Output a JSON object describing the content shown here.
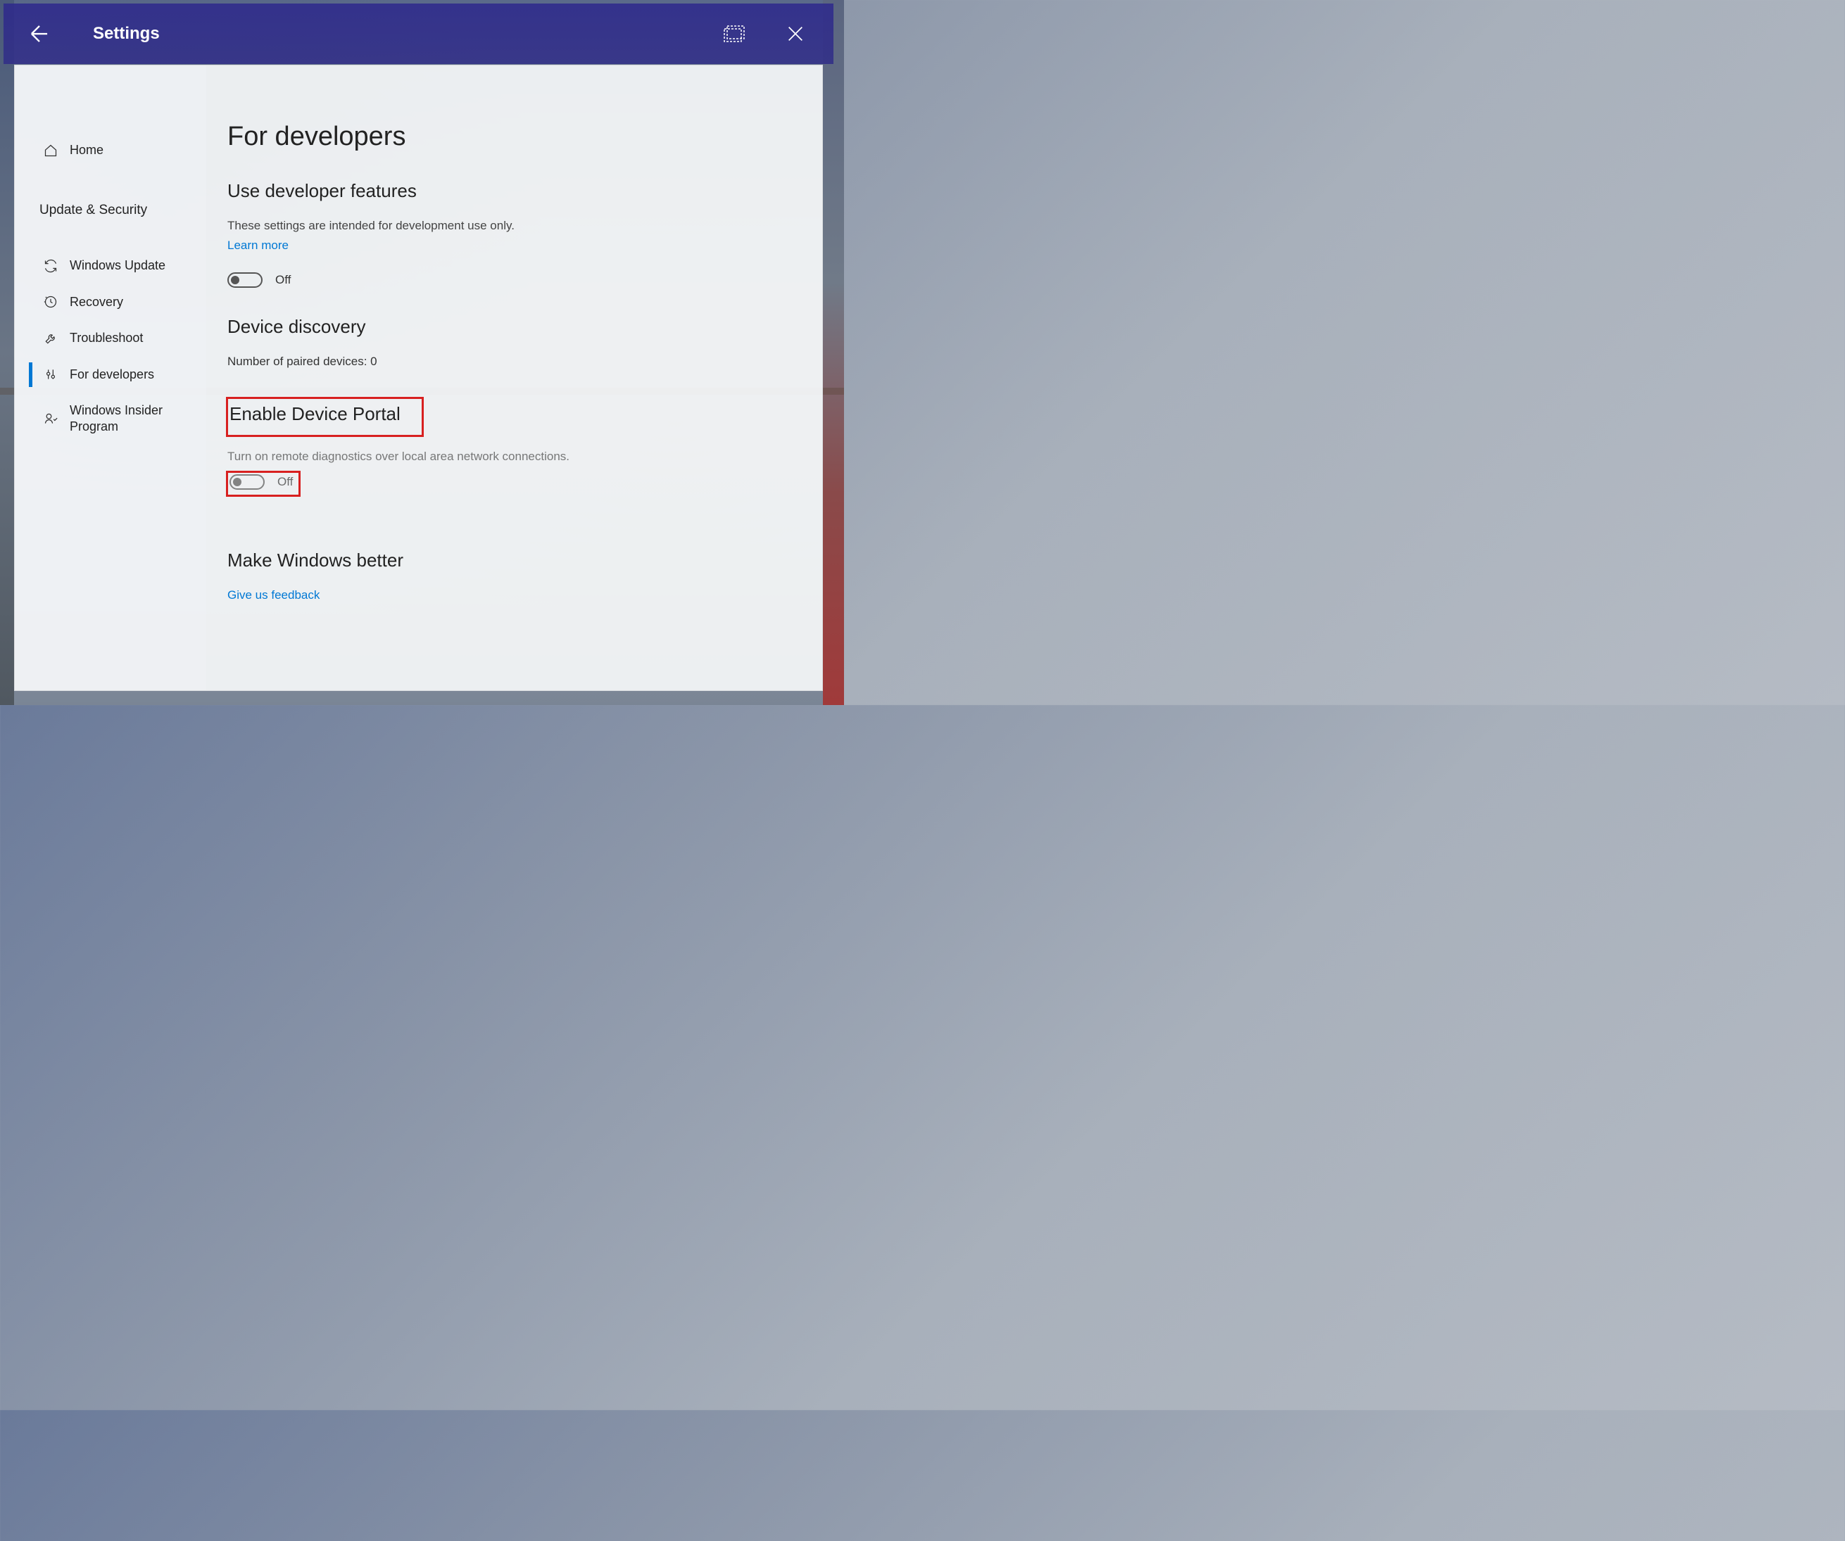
{
  "titlebar": {
    "title": "Settings"
  },
  "sidebar": {
    "home_label": "Home",
    "category_label": "Update & Security",
    "items": [
      {
        "label": "Windows Update"
      },
      {
        "label": "Recovery"
      },
      {
        "label": "Troubleshoot"
      },
      {
        "label": "For developers"
      },
      {
        "label": "Windows Insider Program"
      }
    ]
  },
  "main": {
    "page_title": "For developers",
    "section1": {
      "heading": "Use developer features",
      "description": "These settings are intended for development use only.",
      "learn_more": "Learn more",
      "toggle_label": "Off"
    },
    "section2": {
      "heading": "Device discovery",
      "paired_text": "Number of paired devices: 0"
    },
    "section3": {
      "heading": "Enable Device Portal",
      "description": "Turn on remote diagnostics over local area network connections.",
      "toggle_label": "Off"
    },
    "section4": {
      "heading": "Make Windows better",
      "feedback_link": "Give us feedback"
    }
  },
  "annotation": {
    "highlighted_heading": "Enable Device Portal",
    "highlighted_toggle": "Off"
  }
}
